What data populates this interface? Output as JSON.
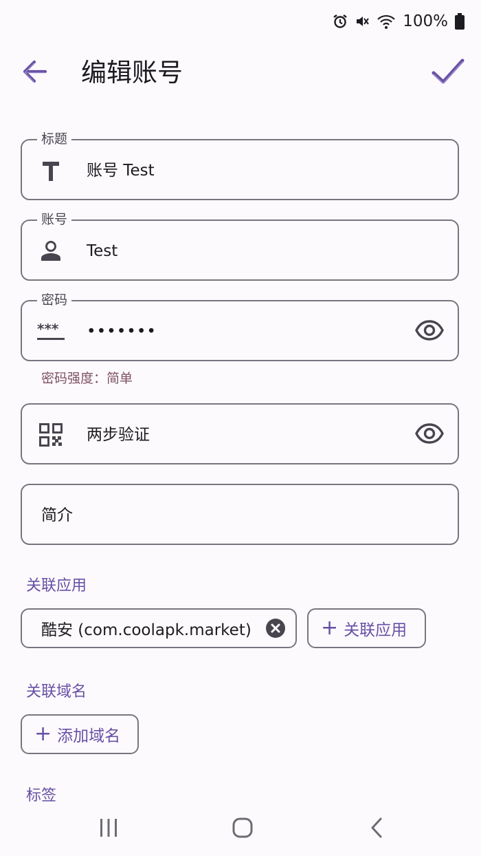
{
  "status_bar": {
    "battery_percent": "100%",
    "icons": [
      "alarm-icon",
      "mute-icon",
      "wifi-icon",
      "battery-icon"
    ]
  },
  "app_bar": {
    "title": "编辑账号",
    "icons": [
      "arrow-back-icon",
      "check-icon"
    ]
  },
  "fields": {
    "title": {
      "label": "标题",
      "value": "账号 Test",
      "icon": "title-t-icon"
    },
    "account": {
      "label": "账号",
      "value": "Test",
      "icon": "person-icon"
    },
    "password": {
      "label": "密码",
      "value": "•••••••",
      "icon": "password-icon",
      "helper": "密码强度：简单"
    },
    "two_factor": {
      "placeholder": "两步验证",
      "icon": "qr-code-icon"
    },
    "description": {
      "placeholder": "简介"
    }
  },
  "linked_apps": {
    "title": "关联应用",
    "chips": [
      {
        "label": "酷安 (com.coolapk.market)"
      }
    ],
    "add_label": "关联应用"
  },
  "linked_domains": {
    "title": "关联域名",
    "add_label": "添加域名"
  },
  "tags": {
    "title": "标签"
  },
  "colors": {
    "accent": "#6750a4",
    "outline": "#79747e",
    "error_helper": "#7d5260",
    "background": "#fdfafe"
  }
}
